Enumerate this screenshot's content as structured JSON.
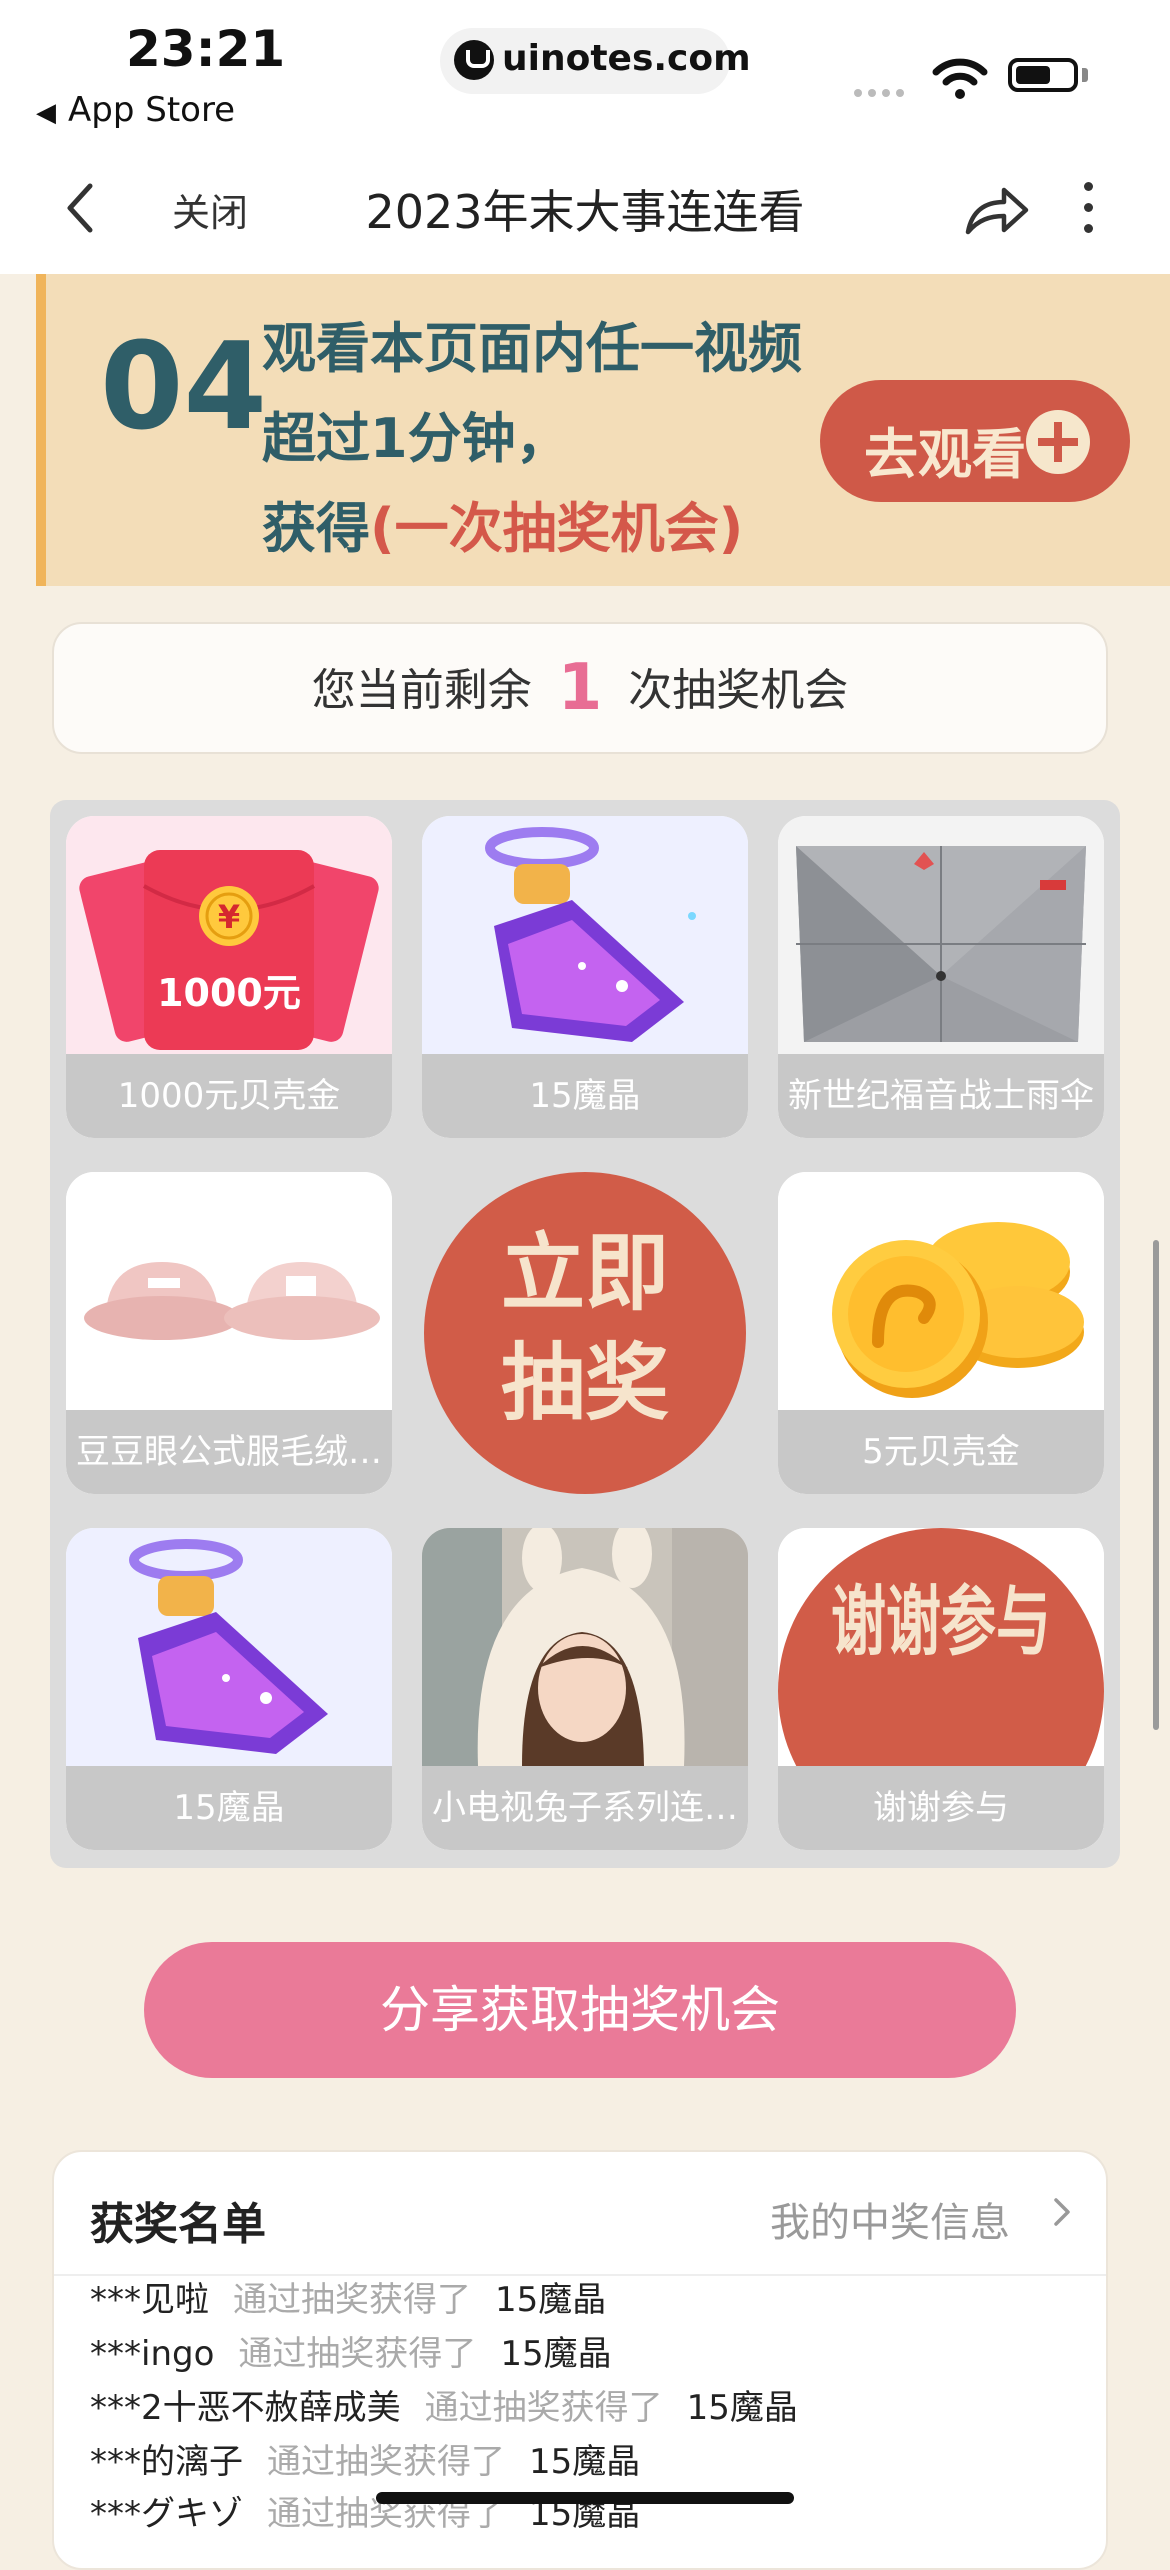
{
  "status_bar": {
    "time": "23:21",
    "back_app": "App Store",
    "url": "uinotes.com"
  },
  "nav": {
    "close_label": "关闭",
    "title": "2023年末大事连连看"
  },
  "task": {
    "number": "04",
    "line1": "观看本页面内任一视频",
    "line2": "超过1分钟，",
    "line3_prefix": "获得",
    "line3_highlight": "(一次抽奖机会)",
    "button_label": "去观看"
  },
  "remaining": {
    "prefix": "您当前剩余",
    "count": "1",
    "suffix": "次抽奖机会"
  },
  "prizes": [
    {
      "label": "1000元贝壳金",
      "art_text": "1000元"
    },
    {
      "label": "15魔晶"
    },
    {
      "label": "新世纪福音战士雨伞"
    },
    {
      "label": "豆豆眼公式服毛绒…"
    },
    {
      "label": "5元贝壳金"
    },
    {
      "label": "15魔晶"
    },
    {
      "label": "小电视兔子系列连…"
    },
    {
      "label": "谢谢参与",
      "art_text": "谢谢参与"
    }
  ],
  "draw_button": {
    "line1": "立即",
    "line2": "抽奖"
  },
  "share_button": "分享获取抽奖机会",
  "winners": {
    "title": "获奖名单",
    "my_info": "我的中奖信息",
    "rows": [
      {
        "user": "***见啦",
        "action": "通过抽奖获得了",
        "prize": "15魔晶"
      },
      {
        "user": "***ingo",
        "action": "通过抽奖获得了",
        "prize": "15魔晶"
      },
      {
        "user": "***2十恶不赦薛成美",
        "action": "通过抽奖获得了",
        "prize": "15魔晶"
      },
      {
        "user": "***的漓子",
        "action": "通过抽奖获得了",
        "prize": "15魔晶"
      },
      {
        "user": "***グキゾ",
        "action": "通过抽奖获得了",
        "prize": "15魔晶"
      }
    ]
  },
  "colors": {
    "accent_red": "#cf5948",
    "accent_pink": "#ea7a98",
    "banner_bg": "#f3ddb8",
    "teal_text": "#2f5e68"
  }
}
